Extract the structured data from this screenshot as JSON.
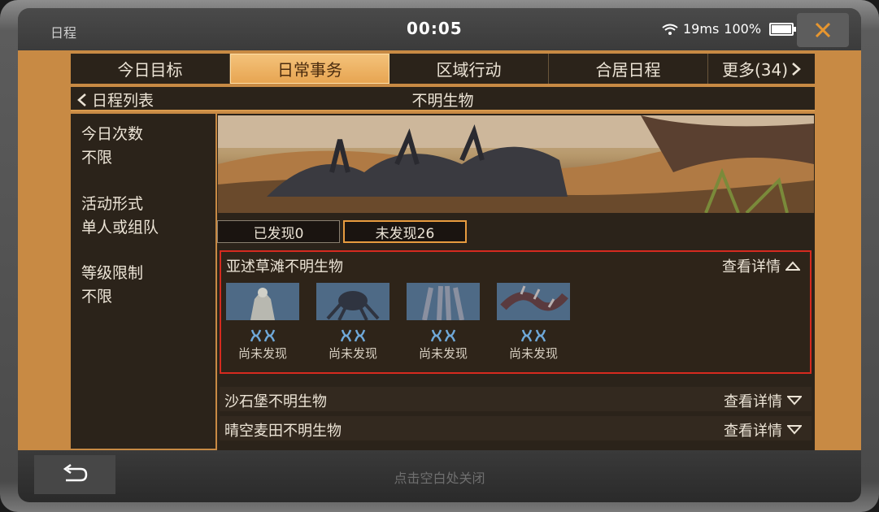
{
  "status_bar": {
    "app_name": "日程",
    "time": "00:05",
    "latency": "19ms",
    "battery": "100%"
  },
  "tabs": [
    {
      "label": "今日目标",
      "active": false
    },
    {
      "label": "日常事务",
      "active": true
    },
    {
      "label": "区域行动",
      "active": false
    },
    {
      "label": "合居日程",
      "active": false
    },
    {
      "label": "更多(34)",
      "active": false
    }
  ],
  "breadcrumb": {
    "back_label": "日程列表",
    "title": "不明生物"
  },
  "info": {
    "daily_count_label": "今日次数",
    "daily_count_value": "不限",
    "form_label": "活动形式",
    "form_value": "单人或组队",
    "level_label": "等级限制",
    "level_value": "不限"
  },
  "filters": {
    "discovered": "已发现0",
    "undiscovered": "未发现26"
  },
  "sections": [
    {
      "title": "亚述草滩不明生物",
      "detail": "查看详情",
      "expanded": true,
      "creatures": [
        {
          "status": "尚未发现",
          "icon": "creature-armored-icon"
        },
        {
          "status": "尚未发现",
          "icon": "creature-spider-icon"
        },
        {
          "status": "尚未发现",
          "icon": "creature-legs-icon"
        },
        {
          "status": "尚未发现",
          "icon": "creature-serpent-icon"
        }
      ]
    },
    {
      "title": "沙石堡不明生物",
      "detail": "查看详情",
      "expanded": false
    },
    {
      "title": "晴空麦田不明生物",
      "detail": "查看详情",
      "expanded": false
    }
  ],
  "footer": {
    "close_hint": "点击空白处关闭"
  },
  "colors": {
    "accent": "#e79b3f",
    "panel": "#2b231a",
    "highlight_border": "#d62a1f",
    "close_icon": "#e7962f"
  }
}
